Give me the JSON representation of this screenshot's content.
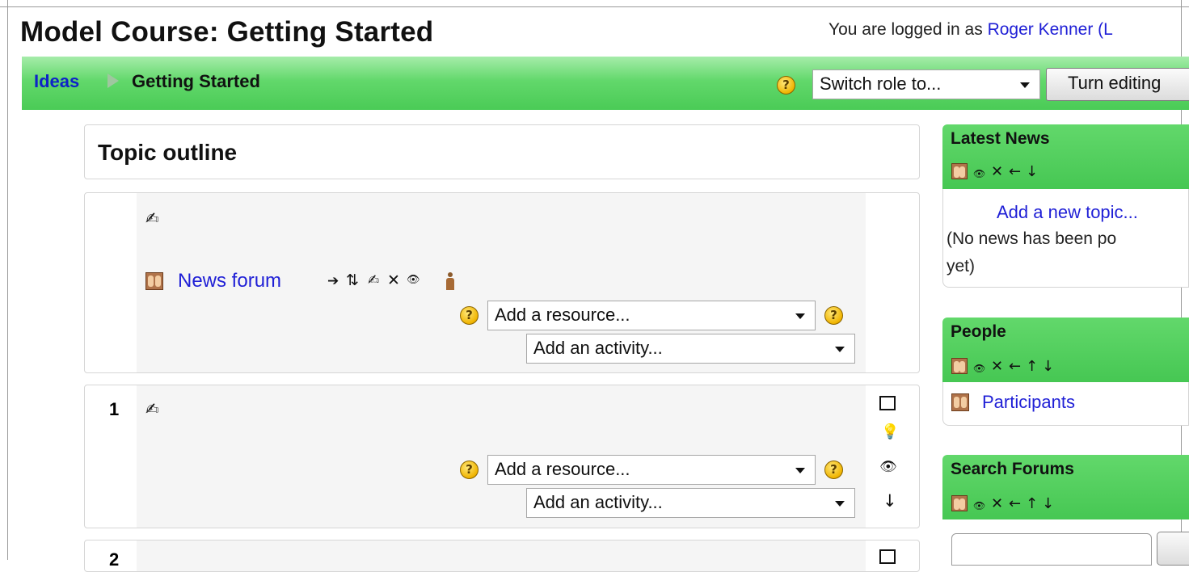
{
  "header": {
    "course_title": "Model Course: Getting Started",
    "login_prefix": "You are logged in as",
    "user_name": "Roger Kenner",
    "logout_fragment": "(L"
  },
  "navbar": {
    "breadcrumb_root": "Ideas",
    "breadcrumb_current": "Getting Started",
    "switch_role_label": "Switch role to...",
    "turn_editing_label": "Turn editing"
  },
  "main": {
    "topic_outline_title": "Topic outline",
    "sections": [
      {
        "number": "",
        "activities": [
          {
            "name": "News forum",
            "type_icon": "forum-icon"
          }
        ],
        "add_resource_placeholder": "Add a resource...",
        "add_activity_placeholder": "Add an activity..."
      },
      {
        "number": "1",
        "activities": [],
        "add_resource_placeholder": "Add a resource...",
        "add_activity_placeholder": "Add an activity..."
      }
    ],
    "next_section_number": "2"
  },
  "blocks": {
    "latest_news": {
      "title": "Latest News",
      "add_topic_link": "Add a new topic...",
      "empty_text_line1": "(No news has been po",
      "empty_text_line2": "yet)"
    },
    "people": {
      "title": "People",
      "participants_link": "Participants"
    },
    "search_forums": {
      "title": "Search Forums"
    }
  },
  "icons": {
    "help": "?",
    "move_right": "➔",
    "move_updown": "⇅",
    "edit": "✍",
    "delete": "✕",
    "show": "👁",
    "left_arrow": "←",
    "up_arrow": "↑",
    "down_arrow": "↓",
    "highlight": "💡"
  },
  "colors": {
    "nav_green": "#4acb56",
    "link_blue": "#1f1fd6"
  }
}
